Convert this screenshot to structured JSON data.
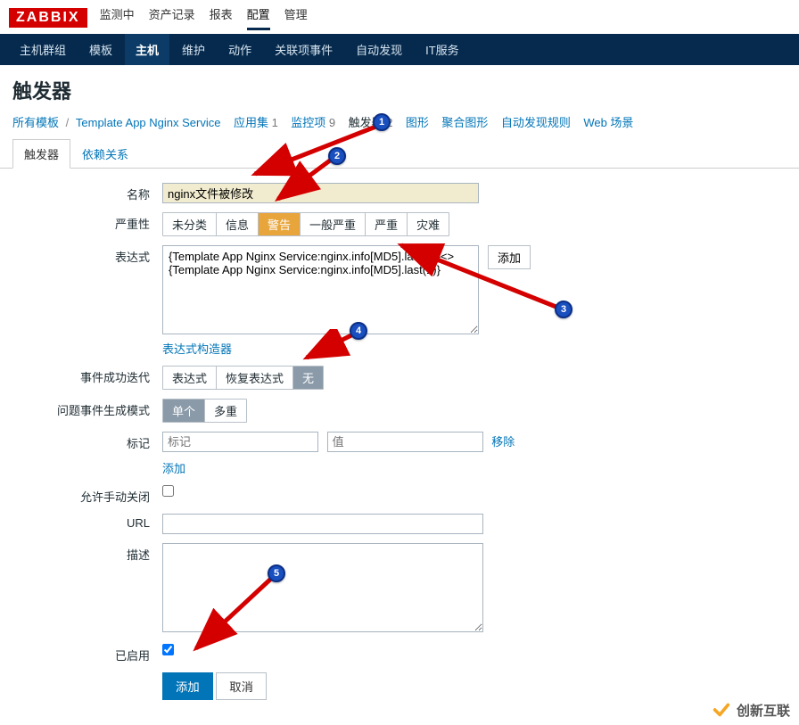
{
  "logo": "ZABBIX",
  "topnav": [
    "监测中",
    "资产记录",
    "报表",
    "配置",
    "管理"
  ],
  "topnav_active": 3,
  "subnav": [
    "主机群组",
    "模板",
    "主机",
    "维护",
    "动作",
    "关联项事件",
    "自动发现",
    "IT服务"
  ],
  "subnav_active": 2,
  "page_title": "触发器",
  "crumbs": {
    "all_templates": "所有模板",
    "template": "Template App Nginx Service",
    "app_set": "应用集",
    "app_set_n": "1",
    "monitor": "监控项",
    "monitor_n": "9",
    "triggers": "触发器",
    "triggers_n": "2",
    "graphs": "图形",
    "aggr": "聚合图形",
    "discover": "自动发现规则",
    "web": "Web 场景"
  },
  "tabs": [
    "触发器",
    "依赖关系"
  ],
  "tabs_active": 0,
  "labels": {
    "name": "名称",
    "severity": "严重性",
    "expression": "表达式",
    "expr_builder": "表达式构造器",
    "event_ok": "事件成功迭代",
    "problem_mode": "问题事件生成模式",
    "tags": "标记",
    "allow_manual": "允许手动关闭",
    "url": "URL",
    "description": "描述",
    "enabled": "已启用"
  },
  "values": {
    "name": "nginx文件被修改",
    "expression": "{Template App Nginx Service:nginx.info[MD5].last(0)}<>{Template App Nginx Service:nginx.info[MD5].last(1)}"
  },
  "severity_opts": [
    "未分类",
    "信息",
    "警告",
    "一般严重",
    "严重",
    "灾难"
  ],
  "severity_sel": 2,
  "event_ok_opts": [
    "表达式",
    "恢复表达式",
    "无"
  ],
  "event_ok_sel": 2,
  "problem_mode_opts": [
    "单个",
    "多重"
  ],
  "problem_mode_sel": 0,
  "placeholders": {
    "tag_key": "标记",
    "tag_val": "值"
  },
  "buttons": {
    "add_expr": "添加",
    "remove": "移除",
    "add_tag": "添加",
    "submit": "添加",
    "cancel": "取消"
  },
  "watermark": "创新互联"
}
